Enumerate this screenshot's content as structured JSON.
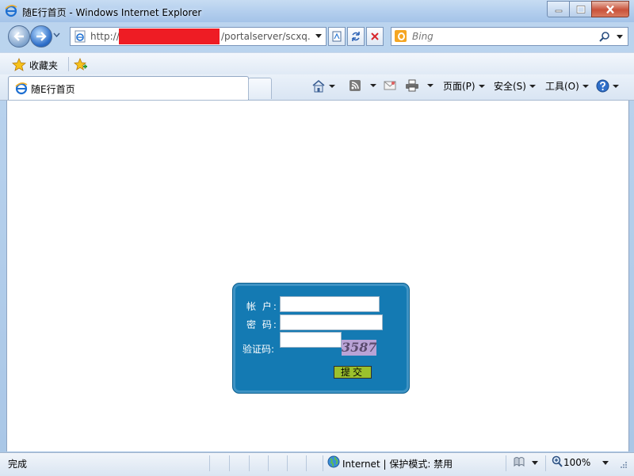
{
  "window": {
    "title": "随E行首页 - Windows Internet Explorer"
  },
  "address": {
    "url_prefix": "http://",
    "url_suffix": "/portalserver/scxq.js"
  },
  "search": {
    "placeholder": "Bing"
  },
  "favorites": {
    "label": "收藏夹"
  },
  "tab": {
    "label": "随E行首页"
  },
  "commands": {
    "page": "页面(P)",
    "safety": "安全(S)",
    "tools": "工具(O)"
  },
  "login": {
    "user_label": "帐 户:",
    "password_label": "密 码:",
    "captcha_label": "验证码:",
    "captcha_code": "3587",
    "submit_label": "提交"
  },
  "status": {
    "text": "完成",
    "zone": "Internet | 保护模式: 禁用",
    "zoom": "100%"
  },
  "colors": {
    "login_box": "#147ab3",
    "submit_button": "#9bc12d",
    "captcha_bg": "#b9a3d6",
    "redaction": "#ee1c24"
  },
  "icons": {
    "browser": "ie-icon",
    "back": "back-arrow-icon",
    "forward": "forward-arrow-icon",
    "refresh": "refresh-icon",
    "stop": "stop-icon",
    "search": "search-icon",
    "favorites": "star-icon",
    "home": "home-icon",
    "feeds": "rss-icon",
    "mail": "mail-icon",
    "print": "printer-icon",
    "help": "help-icon",
    "zone": "globe-icon",
    "zoom": "magnifier-icon"
  }
}
